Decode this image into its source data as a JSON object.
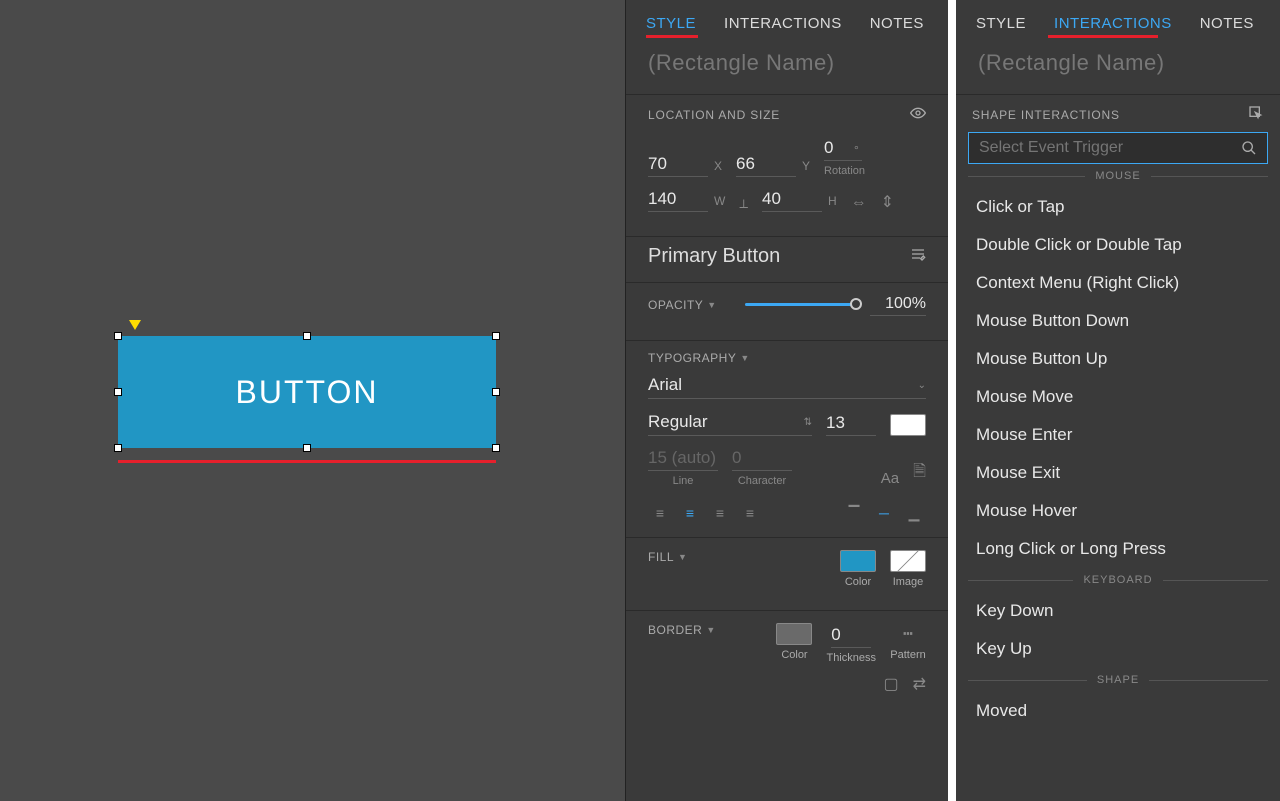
{
  "canvas": {
    "buttonText": "BUTTON"
  },
  "panel1": {
    "tabs": {
      "style": "STYLE",
      "interactions": "INTERACTIONS",
      "notes": "NOTES"
    },
    "rectName": "(Rectangle Name)",
    "locSize": {
      "header": "LOCATION AND SIZE",
      "x": "70",
      "xLabel": "X",
      "y": "66",
      "yLabel": "Y",
      "rot": "0",
      "rotSym": "°",
      "rotLabel": "Rotation",
      "w": "140",
      "wLabel": "W",
      "h": "40",
      "hLabel": "H"
    },
    "styleName": "Primary Button",
    "opacity": {
      "label": "OPACITY",
      "value": "100%"
    },
    "typo": {
      "label": "TYPOGRAPHY",
      "font": "Arial",
      "weight": "Regular",
      "size": "13",
      "line": "15 (auto)",
      "lineLabel": "Line",
      "char": "0",
      "charLabel": "Character"
    },
    "fill": {
      "label": "FILL",
      "colorLabel": "Color",
      "imageLabel": "Image"
    },
    "border": {
      "label": "BORDER",
      "colorLabel": "Color",
      "thickness": "0",
      "thicknessLabel": "Thickness",
      "patternLabel": "Pattern"
    }
  },
  "panel2": {
    "tabs": {
      "style": "STYLE",
      "interactions": "INTERACTIONS",
      "notes": "NOTES"
    },
    "rectName": "(Rectangle Name)",
    "shapeHeader": "SHAPE INTERACTIONS",
    "searchPlaceholder": "Select Event Trigger",
    "groups": {
      "mouse": "MOUSE",
      "keyboard": "KEYBOARD",
      "shape": "SHAPE"
    },
    "events": {
      "click": "Click or Tap",
      "dblclick": "Double Click or Double Tap",
      "context": "Context Menu (Right Click)",
      "mdown": "Mouse Button Down",
      "mup": "Mouse Button Up",
      "mmove": "Mouse Move",
      "menter": "Mouse Enter",
      "mexit": "Mouse Exit",
      "mhover": "Mouse Hover",
      "longclick": "Long Click or Long Press",
      "keydown": "Key Down",
      "keyup": "Key Up",
      "moved": "Moved"
    }
  }
}
